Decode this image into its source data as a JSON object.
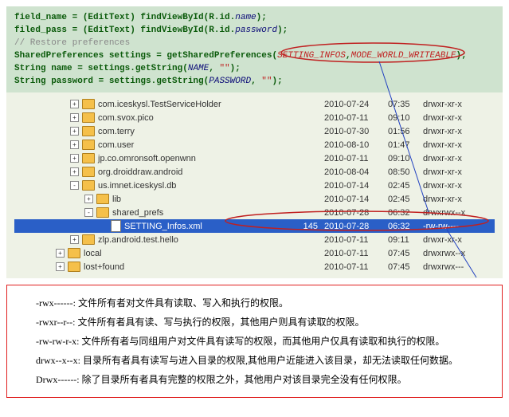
{
  "code": [
    {
      "t": "plain",
      "a": "field_name = (EditText) findViewById(R.id.",
      "b": "name",
      "c": ");"
    },
    {
      "t": "plain",
      "a": "filed_pass = (EditText) findViewById(R.id.",
      "b": "password",
      "c": ");"
    },
    {
      "t": "cmt",
      "a": "// Restore preferences"
    },
    {
      "t": "prefs",
      "a": "SharedPreferences settings = getSharedPreferences(",
      "b": "SETTING_INFOS",
      "c": ",",
      "d": "MODE_WORLD_WRITEABLE",
      "e": ");"
    },
    {
      "t": "get",
      "a": "String name = settings.getString(",
      "b": "NAME",
      "c": ", ",
      "d": "\"\"",
      "e": ");"
    },
    {
      "t": "get",
      "a": "String password = settings.getString(",
      "b": "PASSWORD",
      "c": ", ",
      "d": "\"\"",
      "e": ");"
    }
  ],
  "tree": [
    {
      "ind": 70,
      "tg": "+",
      "ic": "folder",
      "name": "com.iceskysl.TestServiceHolder",
      "size": "",
      "date": "2010-07-24",
      "time": "07:35",
      "perm": "drwxr-xr-x"
    },
    {
      "ind": 70,
      "tg": "+",
      "ic": "folder",
      "name": "com.svox.pico",
      "size": "",
      "date": "2010-07-11",
      "time": "09:10",
      "perm": "drwxr-xr-x"
    },
    {
      "ind": 70,
      "tg": "+",
      "ic": "folder",
      "name": "com.terry",
      "size": "",
      "date": "2010-07-30",
      "time": "01:56",
      "perm": "drwxr-xr-x"
    },
    {
      "ind": 70,
      "tg": "+",
      "ic": "folder",
      "name": "com.user",
      "size": "",
      "date": "2010-08-10",
      "time": "01:47",
      "perm": "drwxr-xr-x"
    },
    {
      "ind": 70,
      "tg": "+",
      "ic": "folder",
      "name": "jp.co.omronsoft.openwnn",
      "size": "",
      "date": "2010-07-11",
      "time": "09:10",
      "perm": "drwxr-xr-x"
    },
    {
      "ind": 70,
      "tg": "+",
      "ic": "folder",
      "name": "org.droiddraw.android",
      "size": "",
      "date": "2010-08-04",
      "time": "08:50",
      "perm": "drwxr-xr-x"
    },
    {
      "ind": 70,
      "tg": "-",
      "ic": "folder",
      "name": "us.imnet.iceskysl.db",
      "size": "",
      "date": "2010-07-14",
      "time": "02:45",
      "perm": "drwxr-xr-x"
    },
    {
      "ind": 88,
      "tg": "+",
      "ic": "folder",
      "name": "lib",
      "size": "",
      "date": "2010-07-14",
      "time": "02:45",
      "perm": "drwxr-xr-x"
    },
    {
      "ind": 88,
      "tg": "-",
      "ic": "folder",
      "name": "shared_prefs",
      "size": "",
      "date": "2010-07-28",
      "time": "06:32",
      "perm": "drwxrwx--x"
    },
    {
      "ind": 106,
      "tg": "",
      "ic": "file",
      "name": "SETTING_Infos.xml",
      "size": "145",
      "date": "2010-07-28",
      "time": "06:32",
      "perm": "-rw-rw----",
      "sel": true
    },
    {
      "ind": 70,
      "tg": "+",
      "ic": "folder",
      "name": "zlp.android.test.hello",
      "size": "",
      "date": "2010-07-11",
      "time": "09:11",
      "perm": "drwxr-xr-x"
    },
    {
      "ind": 52,
      "tg": "+",
      "ic": "folder",
      "name": "local",
      "size": "",
      "date": "2010-07-11",
      "time": "07:45",
      "perm": "drwxrwx--x"
    },
    {
      "ind": 52,
      "tg": "+",
      "ic": "folder",
      "name": "lost+found",
      "size": "",
      "date": "2010-07-11",
      "time": "07:45",
      "perm": "drwxrwx---"
    }
  ],
  "explain": [
    "-rwx------: 文件所有者对文件具有读取、写入和执行的权限。",
    "-rwxr--r--: 文件所有者具有读、写与执行的权限，其他用户则具有读取的权限。",
    "-rw-rw-r-x: 文件所有者与同组用户对文件具有读写的权限，而其他用户仅具有读取和执行的权限。",
    "drwx--x--x: 目录所有者具有读写与进入目录的权限,其他用户近能进入该目录，却无法读取任何数据。",
    "Drwx------: 除了目录所有者具有完整的权限之外，其他用户对该目录完全没有任何权限。"
  ]
}
